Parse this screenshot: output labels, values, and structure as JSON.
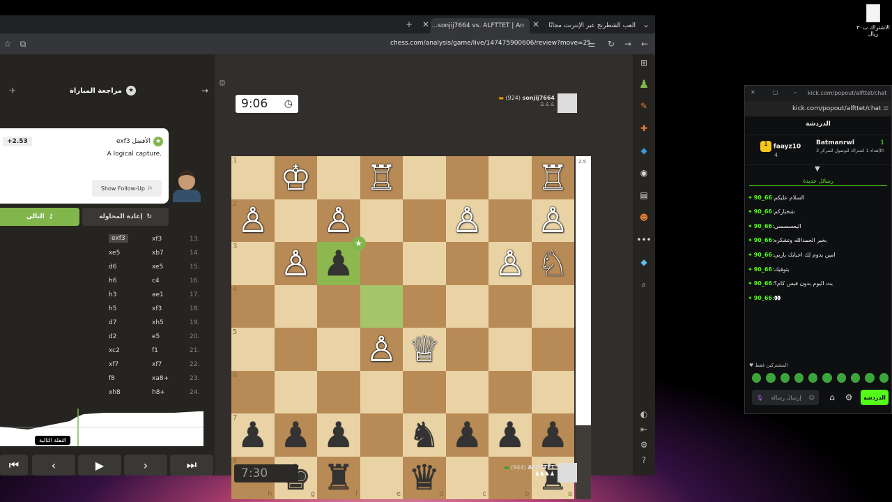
{
  "desktop": {
    "file_label": "الاشتراك ب٣٠ ريال"
  },
  "browser": {
    "tabs": [
      {
        "title": "العب الشطرنج عبر الإنترنت مجانًا"
      },
      {
        "title": "sonjij7664 vs. ALFTTET | An..."
      }
    ],
    "url": "chess.com/analysis/game/live/147475900606/review?move=25"
  },
  "review": {
    "header": "مراجعة المباراة",
    "coach_move": "exf3 الأفضل",
    "coach_text": "A logical capture.",
    "eval": "+2.53",
    "follow_up": "Show Follow-Up",
    "retry": "إعادة المحاولة",
    "next": "التالي",
    "tooltip": "النقلة التالية",
    "moves": [
      {
        "n": "13.",
        "w": "xf3",
        "b": "exf3"
      },
      {
        "n": "14.",
        "w": "xb7",
        "b": "xe5"
      },
      {
        "n": "15.",
        "w": "xe5",
        "b": "d6"
      },
      {
        "n": "16.",
        "w": "c4",
        "b": "h6"
      },
      {
        "n": "17.",
        "w": "ae1",
        "b": "h3"
      },
      {
        "n": "18.",
        "w": "xf3",
        "b": "h5"
      },
      {
        "n": "19.",
        "w": "xh5",
        "b": "d7"
      },
      {
        "n": "20.",
        "w": "e5",
        "b": "d2"
      },
      {
        "n": "21.",
        "w": "f1",
        "b": "xc2"
      },
      {
        "n": "22.",
        "w": "xf7",
        "b": "xf7"
      },
      {
        "n": "23.",
        "w": "xa8+",
        "b": "f8"
      },
      {
        "n": "24.",
        "w": "h8+",
        "b": "xh8"
      }
    ]
  },
  "game": {
    "top_clock": "9:06",
    "bottom_clock": "7:30",
    "top_player": {
      "name": "sonjij7664",
      "rating": "(924)"
    },
    "bottom_player": {
      "name": "ALFTTET",
      "rating": "(944)"
    },
    "eval_top": "2.5",
    "ranks": [
      "1",
      "2",
      "3",
      "4",
      "5",
      "6",
      "7",
      "8"
    ],
    "files": [
      "h",
      "g",
      "f",
      "e",
      "d",
      "c",
      "b",
      "a"
    ],
    "board": [
      [
        "",
        "♚",
        "",
        "♜",
        "",
        "",
        "",
        "♜"
      ],
      [
        "♟",
        "",
        "♟",
        "",
        "",
        "♟",
        "",
        "♟"
      ],
      [
        "",
        "♟",
        "♟",
        "",
        "",
        "",
        "♟",
        "♞"
      ],
      [
        "",
        "",
        "",
        "",
        "",
        "",
        "",
        ""
      ],
      [
        "",
        "",
        "",
        "♟",
        "♛",
        "",
        "",
        ""
      ],
      [
        "",
        "",
        "",
        "",
        "",
        "",
        "",
        ""
      ],
      [
        "♟",
        "♟",
        "♟",
        "",
        "♞",
        "♟",
        "♟",
        "♟"
      ],
      [
        "",
        "♚",
        "♜",
        "",
        "♛",
        "",
        "",
        "♜"
      ]
    ]
  },
  "kick": {
    "url_title": "kick.com/popout/alfttet/chat",
    "url": "kick.com/popout/alfttet/chat",
    "tab": "الدردشة",
    "leader1": {
      "name": "faayz10",
      "count": "4"
    },
    "leader2": {
      "name": "Batmanrwl",
      "count": "1",
      "text": "إهداء 1 اشتراك للوصول للمركز 3th"
    },
    "new_msgs": "رسائل جديدة",
    "messages": [
      {
        "user": "66_90",
        "text": "السلام عليكم"
      },
      {
        "user": "66_90",
        "text": "شخباركم"
      },
      {
        "user": "66_90",
        "text": "اليعسسسي"
      },
      {
        "user": "66_90",
        "text": "بخير الحمدالله وتشكره"
      },
      {
        "user": "66_90",
        "text": "امين يدوم لك احبابك ياربي"
      },
      {
        "user": "66_90",
        "text": "بتوفيك"
      },
      {
        "user": "66_90",
        "text": "بث اليوم بدون فيس كام؟"
      },
      {
        "user": "66_90",
        "text": "👀"
      }
    ],
    "subs_label": "المشتركين فقط",
    "input_placeholder": "إرسال رسالة",
    "chat_button": "الدردشة"
  }
}
